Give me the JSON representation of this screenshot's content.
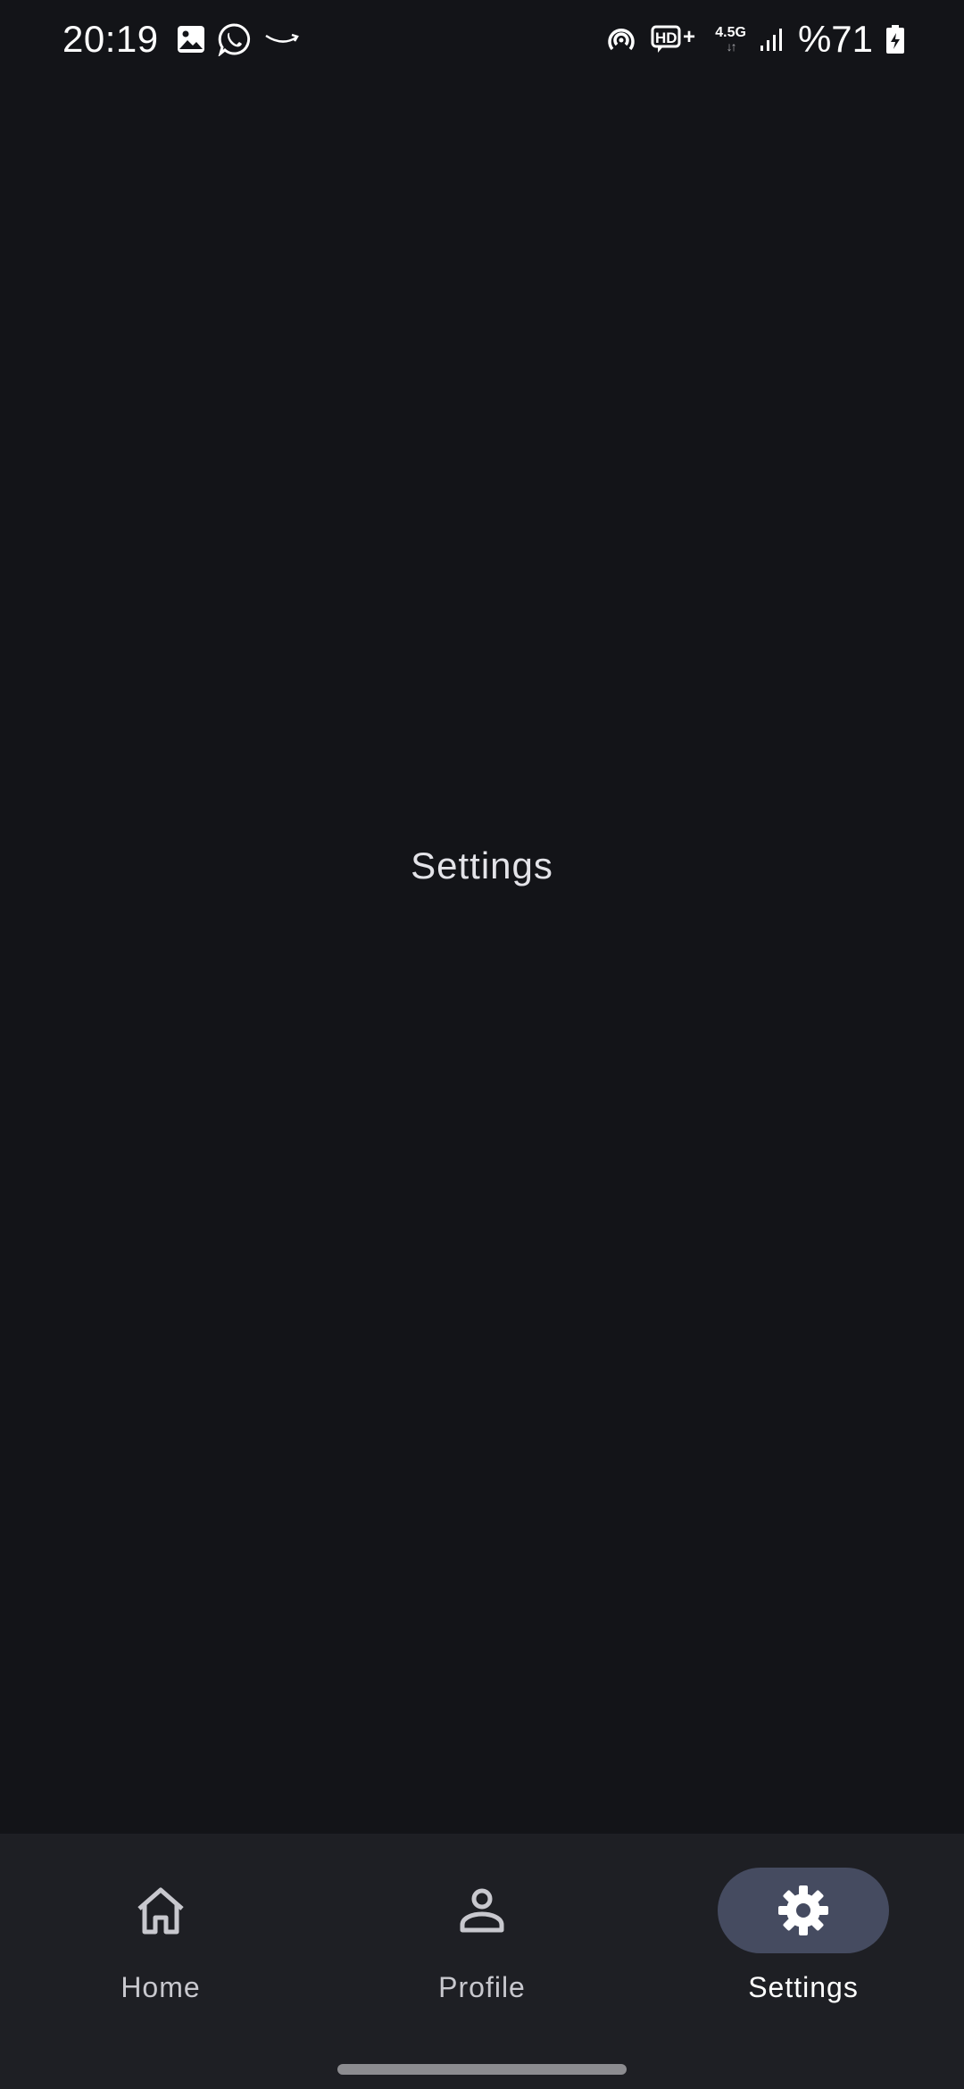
{
  "status_bar": {
    "time": "20:19",
    "left_icons": [
      "gallery-icon",
      "whatsapp-icon",
      "amazon-icon"
    ],
    "right_icons": [
      "hotspot-icon",
      "hd-voice-icon",
      "signal-icon",
      "battery-charging-icon"
    ],
    "network_type": "4.5G",
    "network_arrows": "↓↑",
    "hd_label": "HD+",
    "battery_text": "%71"
  },
  "main": {
    "title": "Settings"
  },
  "bottom_nav": {
    "items": [
      {
        "label": "Home",
        "icon": "home-icon",
        "active": false
      },
      {
        "label": "Profile",
        "icon": "person-icon",
        "active": false
      },
      {
        "label": "Settings",
        "icon": "gear-icon",
        "active": true
      }
    ]
  },
  "colors": {
    "background": "#131418",
    "nav_background": "#1e1f24",
    "active_pill": "#454b60",
    "text": "#e3e3e8"
  }
}
